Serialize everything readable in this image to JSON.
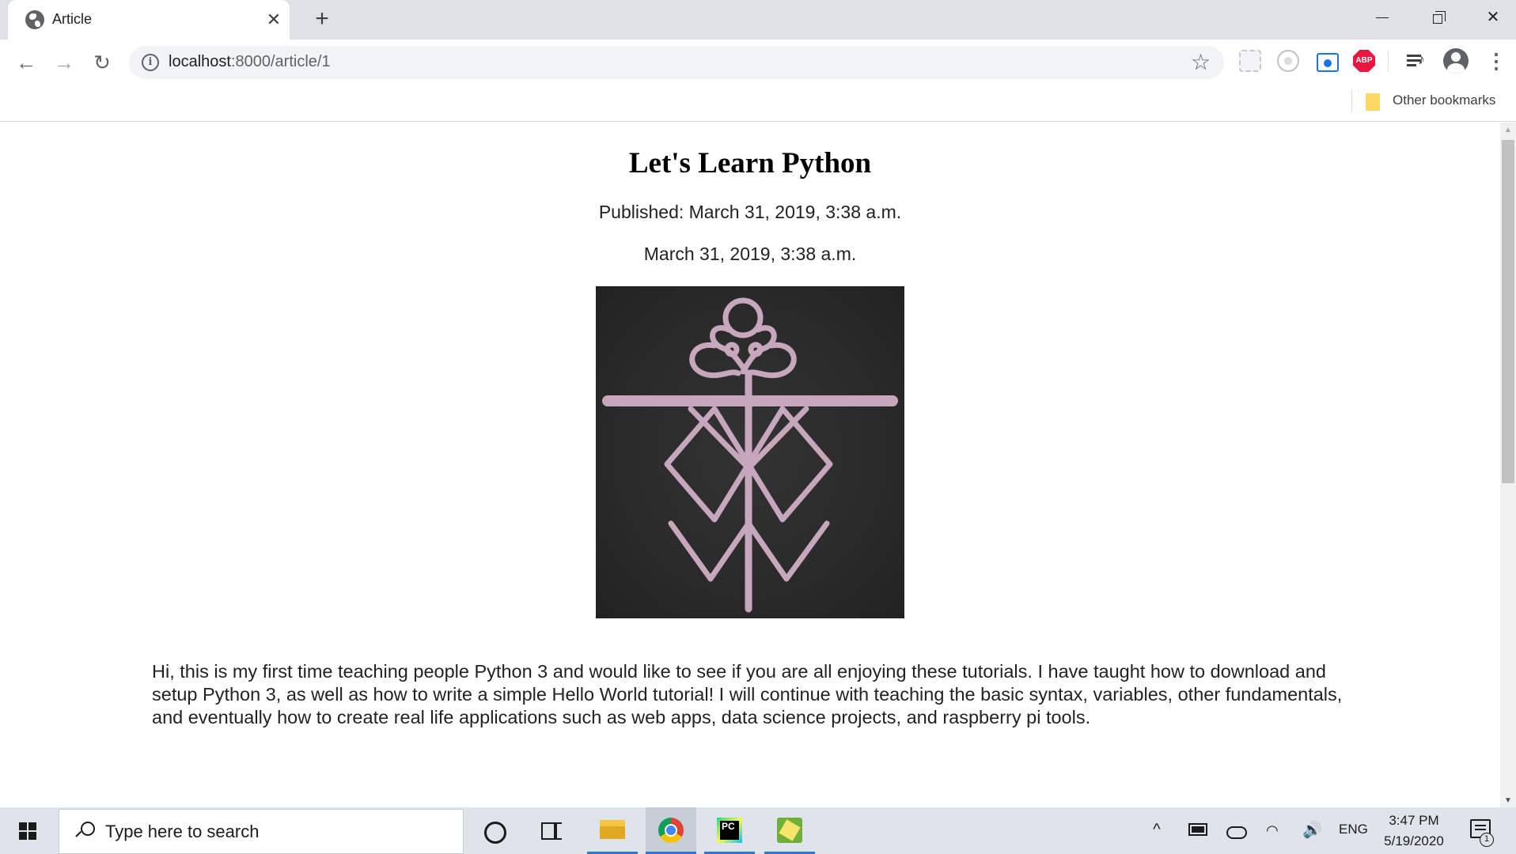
{
  "browser": {
    "tab": {
      "title": "Article",
      "favicon": "globe-icon",
      "close_glyph": "✕"
    },
    "new_tab_glyph": "+",
    "window_controls": {
      "minimize": "minimize-icon",
      "restore": "restore-icon",
      "close_glyph": "✕"
    },
    "toolbar": {
      "back_glyph": "←",
      "forward_glyph": "→",
      "reload_glyph": "↻",
      "url_host": "localhost",
      "url_path": ":8000/article/1",
      "info_glyph": "i",
      "bookmark_star_glyph": "☆",
      "extensions": [
        "extension-icon",
        "extension-icon",
        "screenshot-extension-icon",
        "adblock-plus-icon"
      ],
      "adblock_label": "ABP",
      "menu_glyph": "⋮"
    },
    "bookmarks_bar": {
      "other_bookmarks": "Other bookmarks"
    }
  },
  "article": {
    "title": "Let's Learn Python",
    "published": "Published: March 31, 2019, 3:38 a.m.",
    "date": "March 31, 2019, 3:38 a.m.",
    "image": "rune-symbol-image",
    "body": "Hi, this is my first time teaching people Python 3 and would like to see if you are all enjoying these tutorials. I have taught how to download and setup Python 3, as well as how to write a simple Hello World tutorial! I will continue with teaching the basic syntax, variables, other fundamentals, and eventually how to create real life applications such as web apps, data science projects, and raspberry pi tools."
  },
  "scrollbar": {
    "up_glyph": "▲",
    "down_glyph": "▼"
  },
  "taskbar": {
    "search_placeholder": "Type here to search",
    "pinned_apps": [
      "file-explorer-icon",
      "chrome-icon",
      "pycharm-icon",
      "python-idle-icon"
    ],
    "pycharm_label": "PC",
    "tray": {
      "chevron_glyph": "^",
      "wifi_glyph": "◠",
      "volume_glyph": "🔊",
      "language": "ENG",
      "time": "3:47 PM",
      "date": "5/19/2020",
      "notifications_count": "1"
    },
    "accent_color": "#2b7bd4"
  }
}
